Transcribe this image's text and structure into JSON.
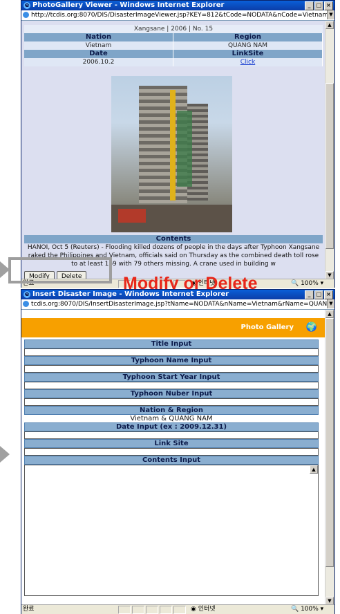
{
  "viewer": {
    "title": "PhotoGallery Viewer - Windows Internet Explorer",
    "url": "http://tcdis.org:8070/DIS/DisasterImageViewer.jsp?KEY=812&tCode=NODATA&nCode=Vietnam&rCode=Q",
    "caption": "Xangsane | 2006 | No. 15",
    "nation_header": "Nation",
    "region_header": "Region",
    "nation_value": "Vietnam",
    "region_value": "QUANG NAM",
    "date_header": "Date",
    "linksite_header": "LinkSite",
    "date_value": "2006.10.2",
    "link_text": "Click",
    "contents_header": "Contents",
    "contents_text": "HANOI, Oct 5 (Reuters) - Flooding killed dozens of people in the days after Typhoon Xangsane raked the Philippines and Vietnam, officials said on Thursday as the combined death toll rose to at least 169 with 79 others missing. A crane used in building w",
    "modify_label": "Modify",
    "delete_label": "Delete",
    "status_left": "완료",
    "status_zone": "인터넷",
    "status_zoom": "100%"
  },
  "annotation": {
    "text": "Modify or Delete"
  },
  "insert": {
    "title": "Insert Disaster Image - Windows Internet Explorer",
    "url": "tcdis.org:8070/DIS/InsertDisasterImage.jsp?tName=NODATA&nName=Vietnam&rName=QUANG%20NAM",
    "banner": "Photo Gallery",
    "title_input": "Title Input",
    "typhoon_name_input": "Typhoon Name Input",
    "typhoon_year_input": "Typhoon Start Year Input",
    "typhoon_number_input": "Typhoon Nuber Input",
    "nation_region_header": "Nation & Region",
    "nation_region_value": "Vietnam & QUANG NAM",
    "date_input": "Date Input (ex : 2009.12.31)",
    "link_site": "Link Site",
    "contents_input": "Contents Input",
    "status_left": "완료",
    "status_zone": "인터넷",
    "status_zoom": "100%"
  }
}
